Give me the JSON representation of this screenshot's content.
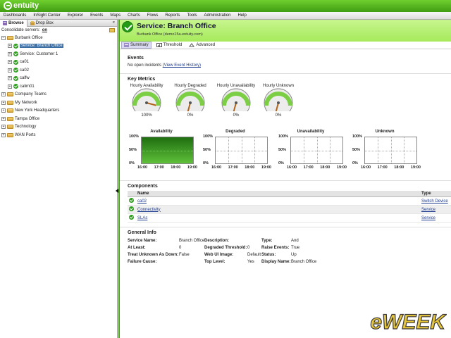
{
  "brand": {
    "logo_text": "entuity",
    "accent": "#46a31a"
  },
  "menu": [
    "Dashboards",
    "InSight Center",
    "Explorer",
    "Events",
    "Maps",
    "Charts",
    "Flows",
    "Reports",
    "Tools",
    "Administration",
    "Help"
  ],
  "left_panel": {
    "tabs": [
      "Browse",
      "Drop Box"
    ],
    "collapse_glyph": "«",
    "consolidate_label": "Consolidate servers:",
    "consolidate_value": "on",
    "tree": [
      {
        "label": "Burbank Office",
        "level": 0,
        "toggle": "−",
        "icon": "folder"
      },
      {
        "label": "Service: Branch Office",
        "level": 1,
        "toggle": "+",
        "icon": "check",
        "selected": true
      },
      {
        "label": "Service: Customer 1",
        "level": 1,
        "toggle": "+",
        "icon": "check"
      },
      {
        "label": "ca01",
        "level": 1,
        "toggle": "+",
        "icon": "check"
      },
      {
        "label": "ca02",
        "level": 1,
        "toggle": "+",
        "icon": "check"
      },
      {
        "label": "calfw",
        "level": 1,
        "toggle": "+",
        "icon": "check"
      },
      {
        "label": "calim01",
        "level": 1,
        "toggle": "+",
        "icon": "check"
      },
      {
        "label": "Company Teams",
        "level": 0,
        "toggle": "+",
        "icon": "folder"
      },
      {
        "label": "My Network",
        "level": 0,
        "toggle": "+",
        "icon": "folder"
      },
      {
        "label": "New York Headquarters",
        "level": 0,
        "toggle": "+",
        "icon": "folder"
      },
      {
        "label": "Tampa Office",
        "level": 0,
        "toggle": "+",
        "icon": "folder"
      },
      {
        "label": "Technology",
        "level": 0,
        "toggle": "+",
        "icon": "folder"
      },
      {
        "label": "WAN Ports",
        "level": 0,
        "toggle": "+",
        "icon": "folder"
      }
    ]
  },
  "service": {
    "title": "Service: Branch Office",
    "subtitle": "Burbank Office (demo15a.entuity.com)",
    "tabs": [
      "Summary",
      "Threshold",
      "Advanced"
    ]
  },
  "events": {
    "title": "Events",
    "text": "No open incidents",
    "link": "(View Event History)"
  },
  "key_metrics": {
    "title": "Key Metrics",
    "gauges": [
      {
        "label": "Hourly Availability",
        "value": 100,
        "pct": "100%"
      },
      {
        "label": "Hourly Degraded",
        "value": 0,
        "pct": "0%"
      },
      {
        "label": "Hourly Unavailability",
        "value": 0,
        "pct": "0%"
      },
      {
        "label": "Hourly Unknown",
        "value": 0,
        "pct": "0%"
      }
    ]
  },
  "chart_data": [
    {
      "type": "area",
      "title": "Availability",
      "x": [
        "16:00",
        "17:00",
        "18:00",
        "19:00"
      ],
      "values": [
        100,
        100,
        100,
        100
      ],
      "ylim": [
        0,
        100
      ],
      "yticks": [
        "100%",
        "50%",
        "0%"
      ]
    },
    {
      "type": "area",
      "title": "Degraded",
      "x": [
        "16:00",
        "17:00",
        "18:00",
        "19:00"
      ],
      "values": [
        0,
        0,
        0,
        0
      ],
      "ylim": [
        0,
        100
      ],
      "yticks": [
        "100%",
        "50%",
        "0%"
      ]
    },
    {
      "type": "area",
      "title": "Unavailability",
      "x": [
        "16:00",
        "17:00",
        "18:00",
        "19:00"
      ],
      "values": [
        0,
        0,
        0,
        0
      ],
      "ylim": [
        0,
        100
      ],
      "yticks": [
        "100%",
        "50%",
        "0%"
      ]
    },
    {
      "type": "area",
      "title": "Unknown",
      "x": [
        "16:00",
        "17:00",
        "18:00",
        "19:00"
      ],
      "values": [
        0,
        0,
        0,
        0
      ],
      "ylim": [
        0,
        100
      ],
      "yticks": [
        "100%",
        "50%",
        "0%"
      ]
    }
  ],
  "components": {
    "title": "Components",
    "headers": [
      "Name",
      "Type"
    ],
    "rows": [
      {
        "name": "ca02",
        "type": "Switch Device"
      },
      {
        "name": "Connectivity",
        "type": "Service"
      },
      {
        "name": "SLAs",
        "type": "Service"
      }
    ]
  },
  "general_info": {
    "title": "General Info",
    "fields": [
      {
        "label": "Service Name:",
        "value": "Branch Office"
      },
      {
        "label": "Description:",
        "value": ""
      },
      {
        "label": "Type:",
        "value": "And"
      },
      {
        "label": "At Least:",
        "value": "0"
      },
      {
        "label": "Degraded Threshold:",
        "value": "0"
      },
      {
        "label": "Raise Events:",
        "value": "True"
      },
      {
        "label": "Treat Unknown As Down:",
        "value": "False"
      },
      {
        "label": "Web UI Image:",
        "value": "Default"
      },
      {
        "label": "Status:",
        "value": "Up"
      },
      {
        "label": "Failure Cause:",
        "value": ""
      },
      {
        "label": "Top Level:",
        "value": "Yes"
      },
      {
        "label": "Display Name:",
        "value": "Branch Office"
      }
    ]
  },
  "watermark": {
    "text": "eWEEK"
  }
}
